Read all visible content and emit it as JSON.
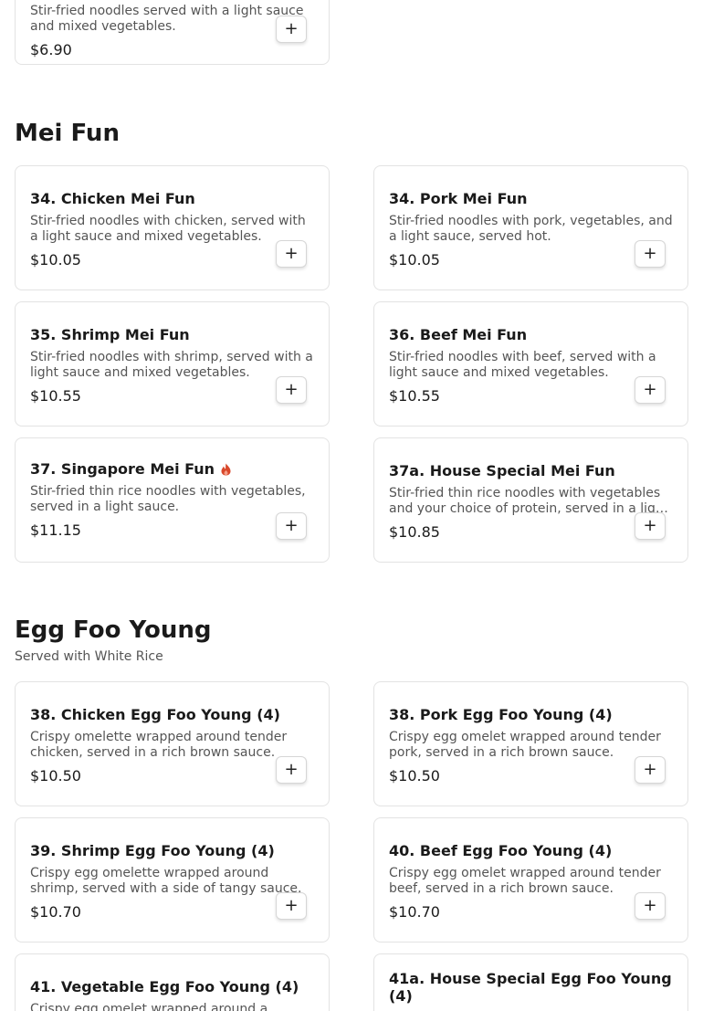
{
  "top_item": {
    "desc": "Stir-fried noodles served with a light sauce and mixed vegetables.",
    "price": "$6.90"
  },
  "sections": {
    "mei_fun": {
      "title": "Mei Fun",
      "items": [
        {
          "name": "34. Chicken Mei Fun",
          "desc": "Stir-fried noodles with chicken, served with a light sauce and mixed vegetables.",
          "price": "$10.05"
        },
        {
          "name": "34. Pork Mei Fun",
          "desc": "Stir-fried noodles with pork, vegetables, and a light sauce, served hot.",
          "price": "$10.05"
        },
        {
          "name": "35. Shrimp Mei Fun",
          "desc": "Stir-fried noodles with shrimp, served with a light sauce and mixed vegetables.",
          "price": "$10.55"
        },
        {
          "name": "36. Beef Mei Fun",
          "desc": "Stir-fried noodles with beef, served with a light sauce and mixed vegetables.",
          "price": "$10.55"
        },
        {
          "name": "37. Singapore Mei Fun",
          "desc": "Stir-fried thin rice noodles with vegetables, served in a light sauce.",
          "price": "$11.15",
          "icon": "spicy-icon"
        },
        {
          "name": "37a. House Special Mei Fun",
          "desc": "Stir-fried thin rice noodles with vegetables and your choice of protein, served in a light sauce.",
          "price": "$10.85"
        }
      ]
    },
    "egg_foo_young": {
      "title": "Egg Foo Young",
      "subtitle": "Served with White Rice",
      "items": [
        {
          "name": "38. Chicken Egg Foo Young (4)",
          "desc": "Crispy omelette wrapped around tender chicken, served in a rich brown sauce.",
          "price": "$10.50"
        },
        {
          "name": "38. Pork Egg Foo Young (4)",
          "desc": "Crispy egg omelet wrapped around tender pork, served in a rich brown sauce.",
          "price": "$10.50"
        },
        {
          "name": "39. Shrimp Egg Foo Young (4)",
          "desc": "Crispy egg omelette wrapped around shrimp, served with a side of tangy sauce.",
          "price": "$10.70"
        },
        {
          "name": "40. Beef Egg Foo Young (4)",
          "desc": "Crispy egg omelet wrapped around tender beef, served in a rich brown sauce.",
          "price": "$10.70"
        },
        {
          "name": "41. Vegetable Egg Foo Young (4)",
          "desc": "Crispy egg omelet wrapped around a"
        },
        {
          "name": "41a. House Special Egg Foo Young (4)"
        }
      ]
    }
  },
  "add_label": "+",
  "colors": {
    "spicy": "#d9482b",
    "border": "#e3e3e3",
    "text": "#1a1a1a",
    "muted": "#555555"
  }
}
